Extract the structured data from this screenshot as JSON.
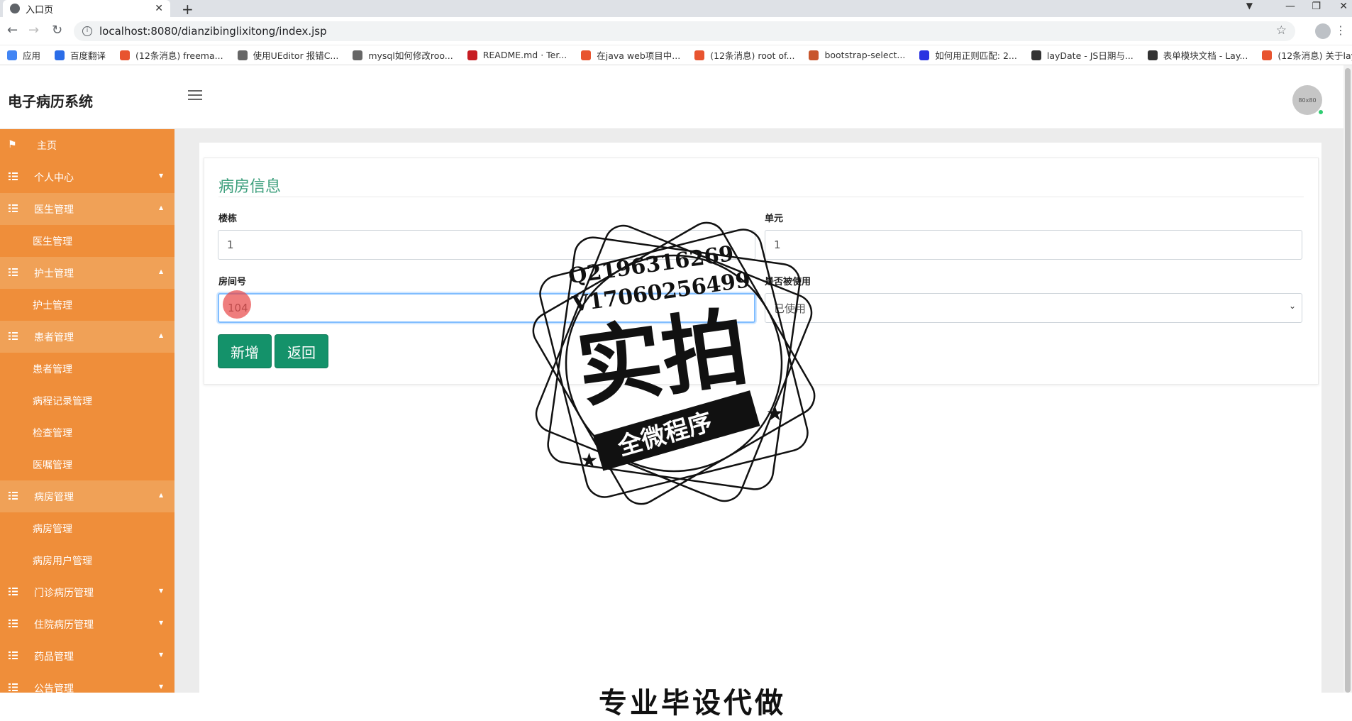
{
  "browser": {
    "tab_title": "入口页",
    "url": "localhost:8080/dianzibinglixitong/index.jsp",
    "bookmarks": [
      {
        "label": "应用",
        "color": "#4285f4"
      },
      {
        "label": "百度翻译",
        "color": "#2b6de8"
      },
      {
        "label": "(12条消息) freema...",
        "color": "#e8542f"
      },
      {
        "label": "使用UEditor 报错C...",
        "color": "#666666"
      },
      {
        "label": "mysql如何修改roo...",
        "color": "#666666"
      },
      {
        "label": "README.md · Ter...",
        "color": "#c71d23"
      },
      {
        "label": "在java web项目中...",
        "color": "#e8542f"
      },
      {
        "label": "(12条消息) root of...",
        "color": "#e8542f"
      },
      {
        "label": "bootstrap-select...",
        "color": "#c8562d"
      },
      {
        "label": "如何用正则匹配: 2...",
        "color": "#2932e1"
      },
      {
        "label": "layDate - JS日期与...",
        "color": "#333333"
      },
      {
        "label": "表单模块文档 - Lay...",
        "color": "#333333"
      },
      {
        "label": "(12条消息) 关于lay...",
        "color": "#e8542f"
      }
    ]
  },
  "header": {
    "app_title": "电子病历系统",
    "avatar_text": "80x80"
  },
  "sidebar": {
    "home": "主页",
    "items": [
      {
        "label": "个人中心",
        "open": false,
        "subs": []
      },
      {
        "label": "医生管理",
        "open": true,
        "subs": [
          "医生管理"
        ]
      },
      {
        "label": "护士管理",
        "open": true,
        "subs": [
          "护士管理"
        ]
      },
      {
        "label": "患者管理",
        "open": true,
        "subs": [
          "患者管理",
          "病程记录管理",
          "检查管理",
          "医嘱管理"
        ]
      },
      {
        "label": "病房管理",
        "open": true,
        "subs": [
          "病房管理",
          "病房用户管理"
        ]
      },
      {
        "label": "门诊病历管理",
        "open": false,
        "subs": []
      },
      {
        "label": "住院病历管理",
        "open": false,
        "subs": []
      },
      {
        "label": "药品管理",
        "open": false,
        "subs": []
      },
      {
        "label": "公告管理",
        "open": false,
        "subs": []
      }
    ]
  },
  "form": {
    "title": "病房信息",
    "building_label": "楼栋",
    "building_value": "1",
    "unit_label": "单元",
    "unit_value": "1",
    "room_label": "房间号",
    "room_value": "104",
    "used_label": "是否被使用",
    "used_value": "已使用",
    "add_button": "新增",
    "back_button": "返回"
  },
  "watermark": {
    "line1": "Q2196316269",
    "line2": "V17060256499",
    "big": "实拍",
    "banner": "全微程序"
  },
  "bottom_text": "专业毕设代做"
}
